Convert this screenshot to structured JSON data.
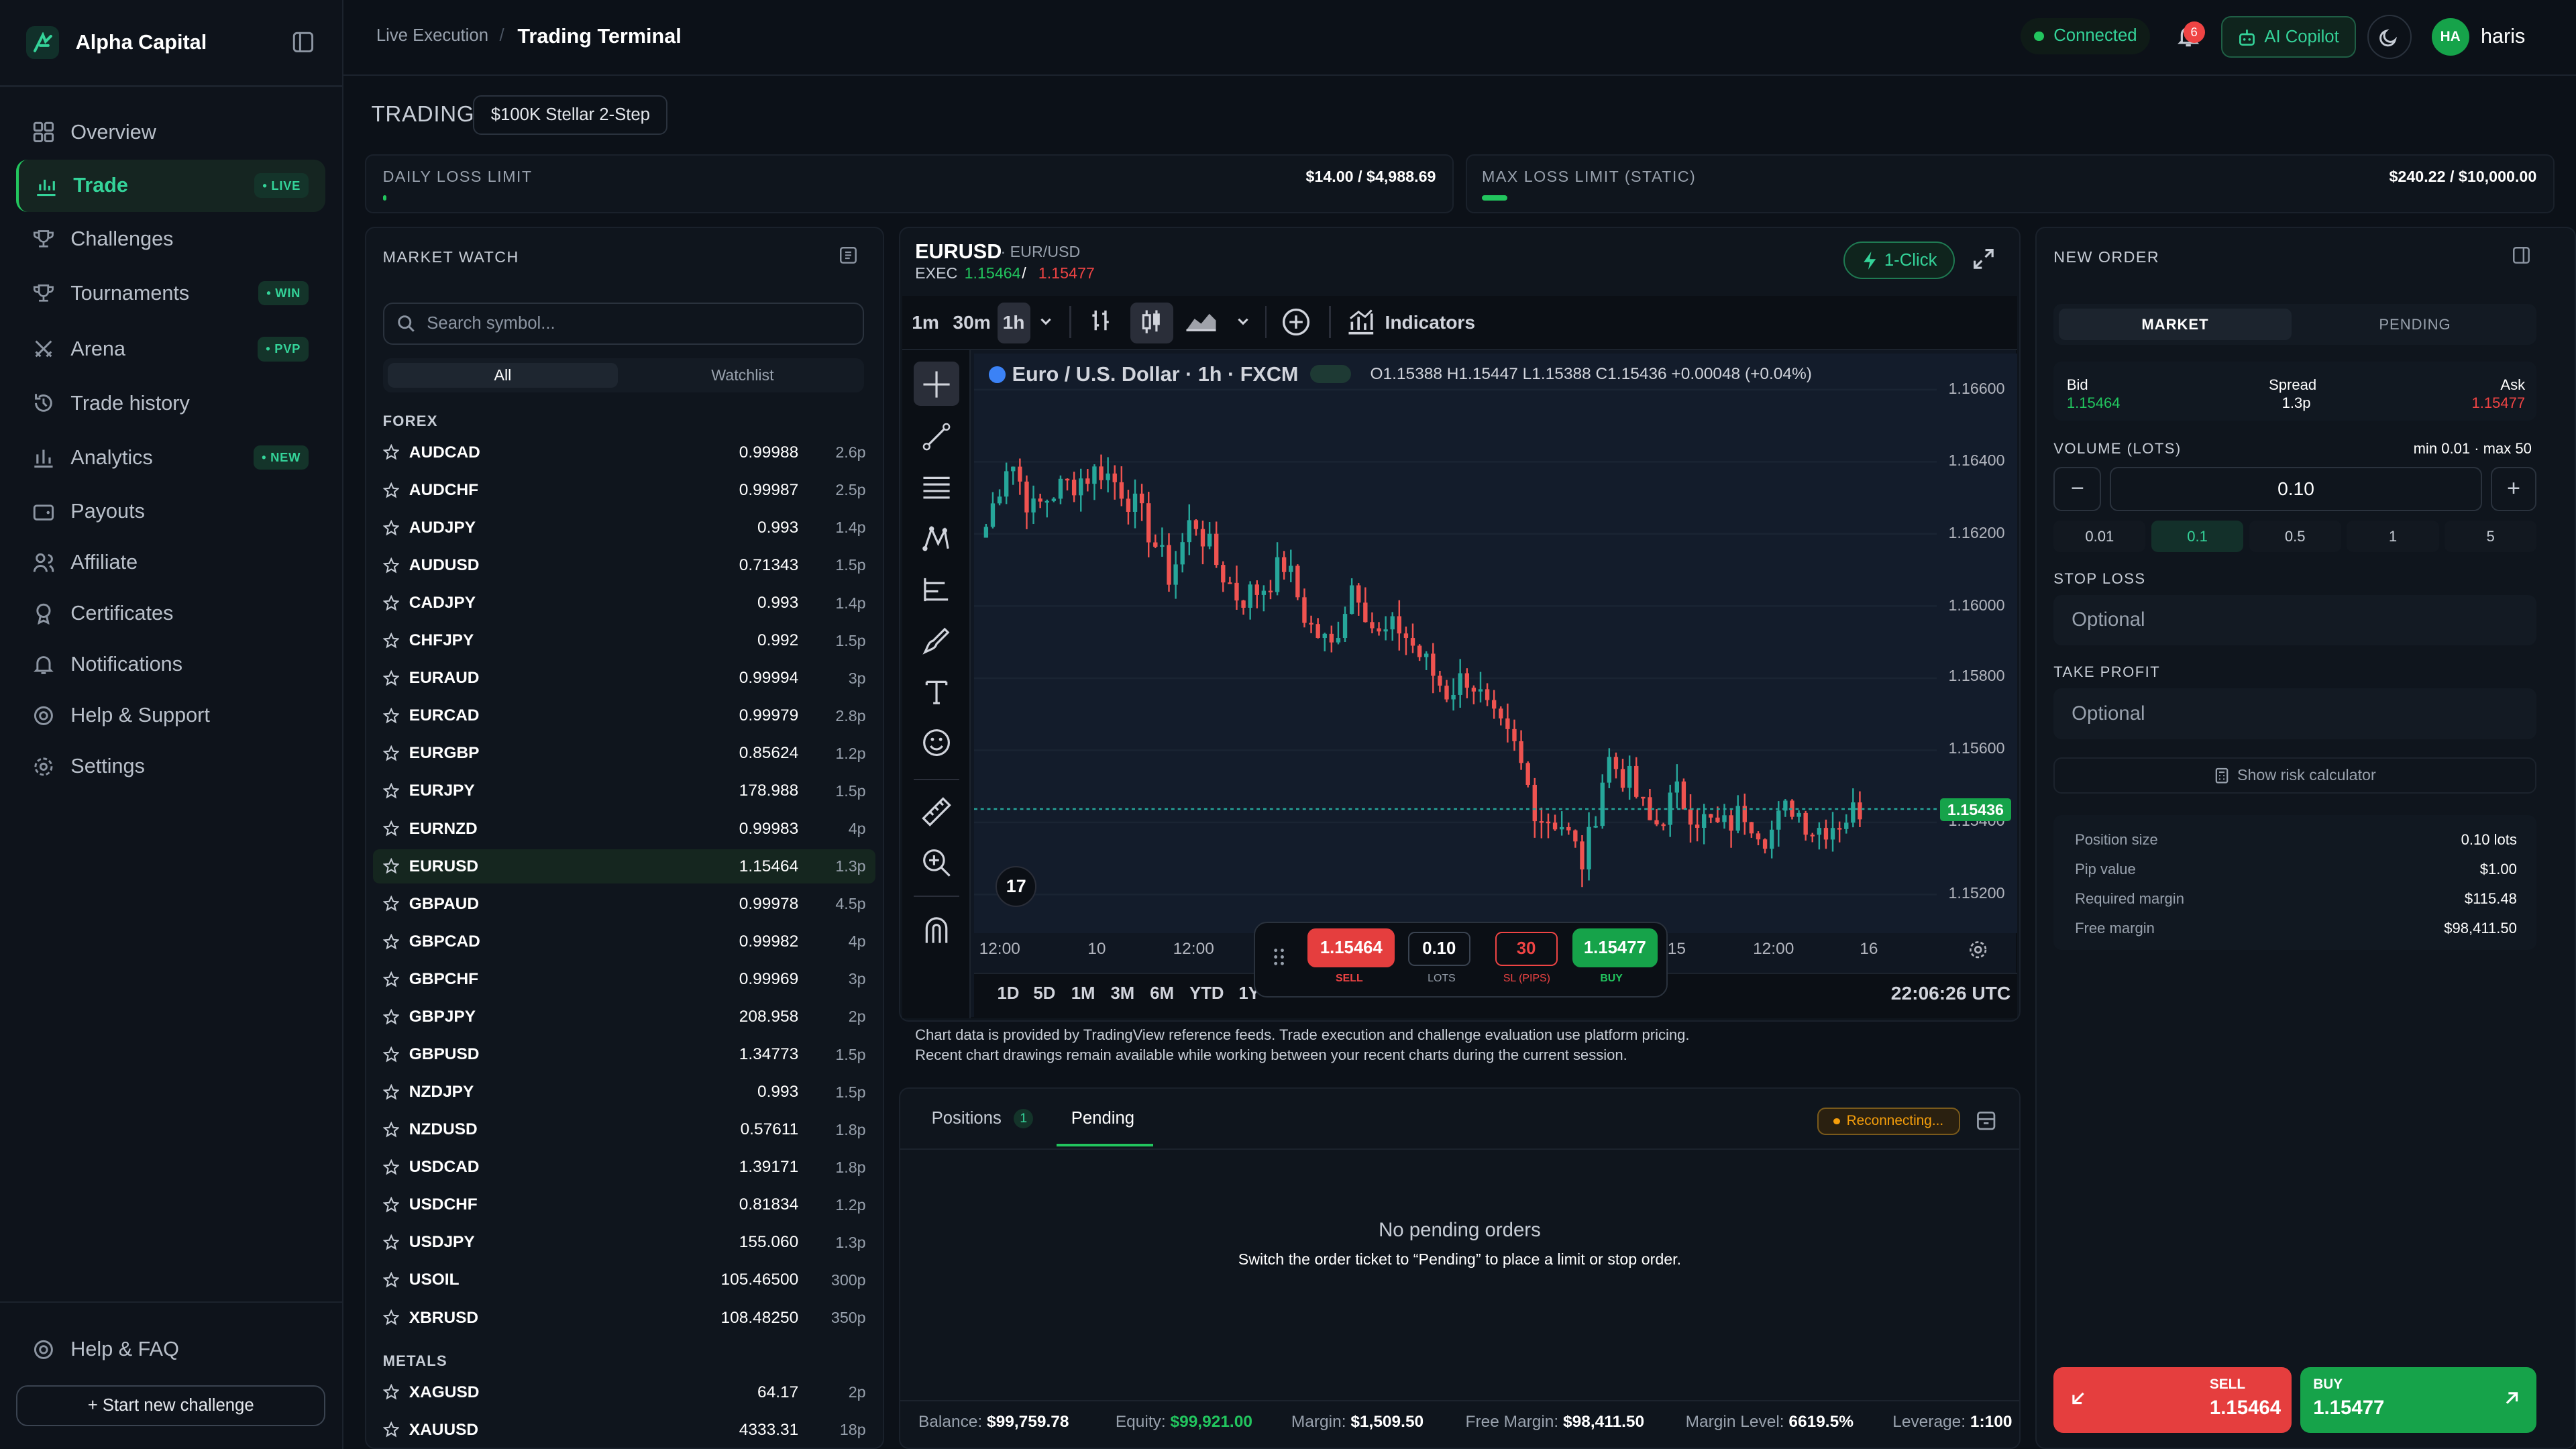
{
  "brand": {
    "name": "Alpha Capital"
  },
  "sidebar": {
    "items": [
      {
        "label": "Overview",
        "badge": ""
      },
      {
        "label": "Trade",
        "badge": "• LIVE"
      },
      {
        "label": "Challenges",
        "badge": ""
      },
      {
        "label": "Tournaments",
        "badge": "• WIN"
      },
      {
        "label": "Arena",
        "badge": "• PVP"
      },
      {
        "label": "Trade history",
        "badge": ""
      },
      {
        "label": "Analytics",
        "badge": "• NEW"
      },
      {
        "label": "Payouts",
        "badge": ""
      },
      {
        "label": "Affiliate",
        "badge": ""
      },
      {
        "label": "Certificates",
        "badge": ""
      },
      {
        "label": "Notifications",
        "badge": ""
      },
      {
        "label": "Help & Support",
        "badge": ""
      },
      {
        "label": "Settings",
        "badge": ""
      }
    ],
    "help_faq": "Help & FAQ",
    "new_challenge": "+ Start new challenge"
  },
  "topbar": {
    "crumb_parent": "Live Execution",
    "crumb_current": "Trading Terminal",
    "status": "Connected",
    "notification_count": "6",
    "copilot": "AI Copilot",
    "avatar_initials": "HA",
    "username": "haris"
  },
  "trading": {
    "title": "TRADING",
    "account": "$100K Stellar 2-Step",
    "daily_loss_label": "DAILY LOSS LIMIT",
    "daily_loss_value": "$14.00 / $4,988.69",
    "daily_loss_fraction": 0.003,
    "max_loss_label": "MAX LOSS LIMIT (STATIC)",
    "max_loss_value": "$240.22 / $10,000.00",
    "max_loss_fraction": 0.024
  },
  "market_watch": {
    "title": "MARKET WATCH",
    "search_placeholder": "Search symbol...",
    "tab_all": "All",
    "tab_watchlist": "Watchlist",
    "group_forex": "FOREX",
    "group_metals": "METALS",
    "forex": [
      {
        "symbol": "AUDCAD",
        "price": "0.99988",
        "spread": "2.6p"
      },
      {
        "symbol": "AUDCHF",
        "price": "0.99987",
        "spread": "2.5p"
      },
      {
        "symbol": "AUDJPY",
        "price": "0.993",
        "spread": "1.4p"
      },
      {
        "symbol": "AUDUSD",
        "price": "0.71343",
        "spread": "1.5p"
      },
      {
        "symbol": "CADJPY",
        "price": "0.993",
        "spread": "1.4p"
      },
      {
        "symbol": "CHFJPY",
        "price": "0.992",
        "spread": "1.5p"
      },
      {
        "symbol": "EURAUD",
        "price": "0.99994",
        "spread": "3p"
      },
      {
        "symbol": "EURCAD",
        "price": "0.99979",
        "spread": "2.8p"
      },
      {
        "symbol": "EURGBP",
        "price": "0.85624",
        "spread": "1.2p"
      },
      {
        "symbol": "EURJPY",
        "price": "178.988",
        "spread": "1.5p"
      },
      {
        "symbol": "EURNZD",
        "price": "0.99983",
        "spread": "4p"
      },
      {
        "symbol": "EURUSD",
        "price": "1.15464",
        "spread": "1.3p",
        "selected": true
      },
      {
        "symbol": "GBPAUD",
        "price": "0.99978",
        "spread": "4.5p"
      },
      {
        "symbol": "GBPCAD",
        "price": "0.99982",
        "spread": "4p"
      },
      {
        "symbol": "GBPCHF",
        "price": "0.99969",
        "spread": "3p"
      },
      {
        "symbol": "GBPJPY",
        "price": "208.958",
        "spread": "2p"
      },
      {
        "symbol": "GBPUSD",
        "price": "1.34773",
        "spread": "1.5p"
      },
      {
        "symbol": "NZDJPY",
        "price": "0.993",
        "spread": "1.5p"
      },
      {
        "symbol": "NZDUSD",
        "price": "0.57611",
        "spread": "1.8p"
      },
      {
        "symbol": "USDCAD",
        "price": "1.39171",
        "spread": "1.8p"
      },
      {
        "symbol": "USDCHF",
        "price": "0.81834",
        "spread": "1.2p"
      },
      {
        "symbol": "USDJPY",
        "price": "155.060",
        "spread": "1.3p"
      },
      {
        "symbol": "USOIL",
        "price": "105.46500",
        "spread": "300p"
      },
      {
        "symbol": "XBRUSD",
        "price": "108.48250",
        "spread": "350p"
      }
    ],
    "metals": [
      {
        "symbol": "XAGUSD",
        "price": "64.17",
        "spread": "2p"
      },
      {
        "symbol": "XAUUSD",
        "price": "4333.31",
        "spread": "18p"
      }
    ]
  },
  "chart_panel": {
    "symbol": "EURUSD",
    "symbol_sub": "· EUR/USD",
    "exec_label": "EXEC",
    "exec_bid": "1.15464",
    "exec_sep": "/",
    "exec_ask": "1.15477",
    "one_click": "1-Click",
    "timeframes": [
      "1m",
      "30m",
      "1h"
    ],
    "indicators": "Indicators",
    "legend_title": "Euro / U.S. Dollar · 1h · FXCM",
    "legend_ohlc": "O1.15388 H1.15447 L1.15388 C1.15436 +0.00048 (+0.04%)",
    "last_price": "1.15436",
    "ranges": [
      "1D",
      "5D",
      "1M",
      "3M",
      "6M",
      "YTD",
      "1Y"
    ],
    "clock": "22:06:26 UTC",
    "note_line1": "Chart data is provided by TradingView reference feeds. Trade execution and challenge evaluation use platform pricing.",
    "note_line2": "Recent chart drawings remain available while working between your recent charts during the current session.",
    "quick_trade": {
      "sell_price": "1.15464",
      "sell_label": "SELL",
      "lots": "0.10",
      "lots_label": "LOTS",
      "sl": "30",
      "sl_label": "SL (PIPS)",
      "buy_price": "1.15477",
      "buy_label": "BUY"
    }
  },
  "chart_data": {
    "type": "candlestick",
    "ylim": [
      1.1515,
      1.1668
    ],
    "y_ticks": [
      "1.16600",
      "1.16400",
      "1.16200",
      "1.16000",
      "1.15800",
      "1.15600",
      "1.15400",
      "1.15200"
    ],
    "x_ticks": [
      "12:00",
      "10",
      "12:00",
      "15",
      "12:00",
      "16"
    ],
    "close_path": [
      1.1622,
      1.1642,
      1.1626,
      1.1632,
      1.1635,
      1.1638,
      1.1632,
      1.1622,
      1.1608,
      1.1625,
      1.1612,
      1.1602,
      1.1605,
      1.1612,
      1.1595,
      1.1588,
      1.1608,
      1.1591,
      1.1594,
      1.1585,
      1.1576,
      1.1581,
      1.1568,
      1.156,
      1.1542,
      1.154,
      1.1528,
      1.1558,
      1.1551,
      1.1538,
      1.1548,
      1.1541,
      1.1538,
      1.1543,
      1.1536,
      1.1545,
      1.1538,
      1.154,
      1.1544
    ]
  },
  "positions": {
    "tab_positions": "Positions",
    "positions_count": "1",
    "tab_pending": "Pending",
    "status": "Reconnecting...",
    "empty_title": "No pending orders",
    "empty_sub": "Switch the order ticket to “Pending” to place a limit or stop order.",
    "balance_label": "Balance:",
    "balance": "$99,759.78",
    "equity_label": "Equity:",
    "equity": "$99,921.00",
    "margin_label": "Margin:",
    "margin": "$1,509.50",
    "free_margin_label": "Free Margin:",
    "free_margin": "$98,411.50",
    "margin_level_label": "Margin Level:",
    "margin_level": "6619.5%",
    "leverage_label": "Leverage:",
    "leverage": "1:100"
  },
  "new_order": {
    "title": "NEW ORDER",
    "tab_market": "MARKET",
    "tab_pending": "PENDING",
    "bid_label": "Bid",
    "bid": "1.15464",
    "spread_label": "Spread",
    "spread": "1.3p",
    "ask_label": "Ask",
    "ask": "1.15477",
    "volume_label": "VOLUME (LOTS)",
    "volume_range": "min 0.01 · max 50",
    "volume": "0.10",
    "presets": [
      "0.01",
      "0.1",
      "0.5",
      "1",
      "5"
    ],
    "stop_loss_label": "STOP LOSS",
    "stop_loss_placeholder": "Optional",
    "take_profit_label": "TAKE PROFIT",
    "take_profit_placeholder": "Optional",
    "risk_calc": "Show risk calculator",
    "position_size_label": "Position size",
    "position_size": "0.10 lots",
    "pip_value_label": "Pip value",
    "pip_value": "$1.00",
    "required_margin_label": "Required margin",
    "required_margin": "$115.48",
    "free_margin_label": "Free margin",
    "free_margin": "$98,411.50",
    "sell_label": "SELL",
    "sell_price": "1.15464",
    "buy_label": "BUY",
    "buy_price": "1.15477"
  },
  "colors": {
    "accent": "#22c55e",
    "sell": "#e53e3e",
    "buy": "#16a34a",
    "bg": "#0c1118",
    "chart_bg": "#131c2b"
  }
}
